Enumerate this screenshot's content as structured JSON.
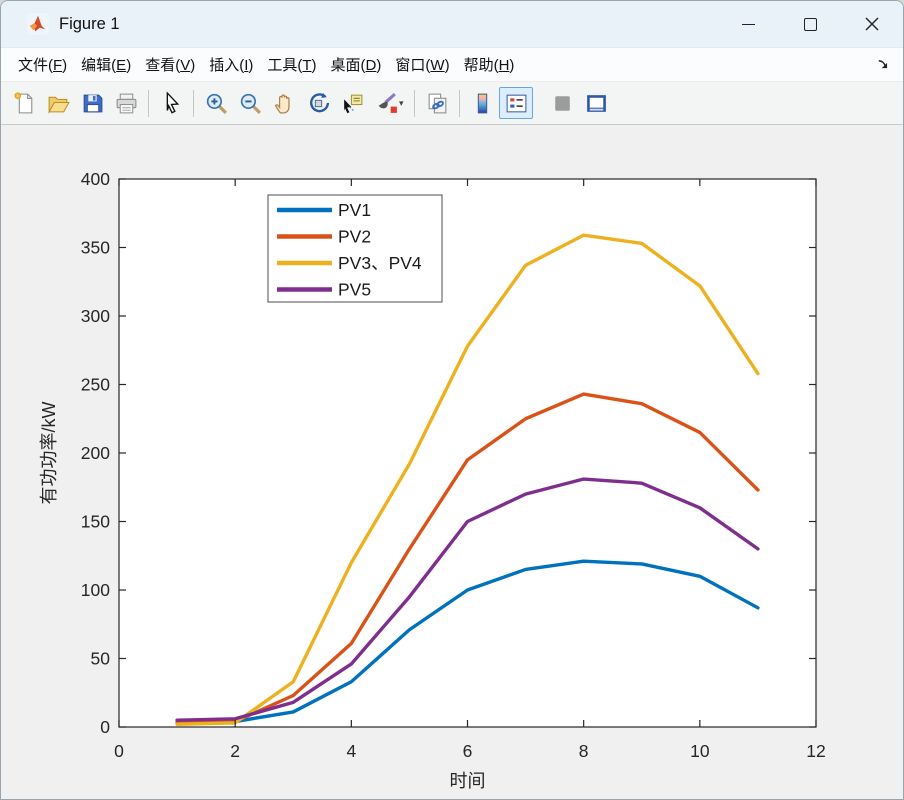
{
  "window": {
    "title": "Figure 1"
  },
  "menu": {
    "items": [
      "文件(F)",
      "编辑(E)",
      "查看(V)",
      "插入(I)",
      "工具(T)",
      "桌面(D)",
      "窗口(W)",
      "帮助(H)"
    ]
  },
  "toolbar": {
    "buttons": [
      "new-figure",
      "open-file",
      "save-figure",
      "print-figure",
      "edit-cursor",
      "zoom-in",
      "zoom-out",
      "pan",
      "rotate-3d",
      "data-cursor",
      "brush-data",
      "link-plot",
      "insert-colorbar",
      "insert-legend",
      "plot-tools-disabled",
      "dock-figure"
    ],
    "active_button": "insert-legend"
  },
  "chart_data": {
    "type": "line",
    "x": [
      1,
      2,
      3,
      4,
      5,
      6,
      7,
      8,
      9,
      10,
      11
    ],
    "series": [
      {
        "name": "PV1",
        "color": "#0072BD",
        "values": [
          3,
          4,
          11,
          33,
          71,
          100,
          115,
          121,
          119,
          110,
          87
        ]
      },
      {
        "name": "PV2",
        "color": "#D95319",
        "values": [
          3,
          4,
          23,
          61,
          130,
          195,
          225,
          243,
          236,
          215,
          173
        ]
      },
      {
        "name": "PV3、PV4",
        "color": "#EDB120",
        "values": [
          2,
          3,
          33,
          120,
          192,
          278,
          337,
          359,
          353,
          322,
          258
        ]
      },
      {
        "name": "PV5",
        "color": "#7E2F8E",
        "values": [
          5,
          6,
          18,
          46,
          95,
          150,
          170,
          181,
          178,
          160,
          130
        ]
      }
    ],
    "xlabel": "时间",
    "ylabel": "有功功率/kW",
    "xlim": [
      0,
      12
    ],
    "ylim": [
      0,
      400
    ],
    "xticks": [
      0,
      2,
      4,
      6,
      8,
      10,
      12
    ],
    "yticks": [
      0,
      50,
      100,
      150,
      200,
      250,
      300,
      350,
      400
    ],
    "grid": false,
    "legend_position": "upper-left-inside",
    "axis_color": "#262626"
  }
}
